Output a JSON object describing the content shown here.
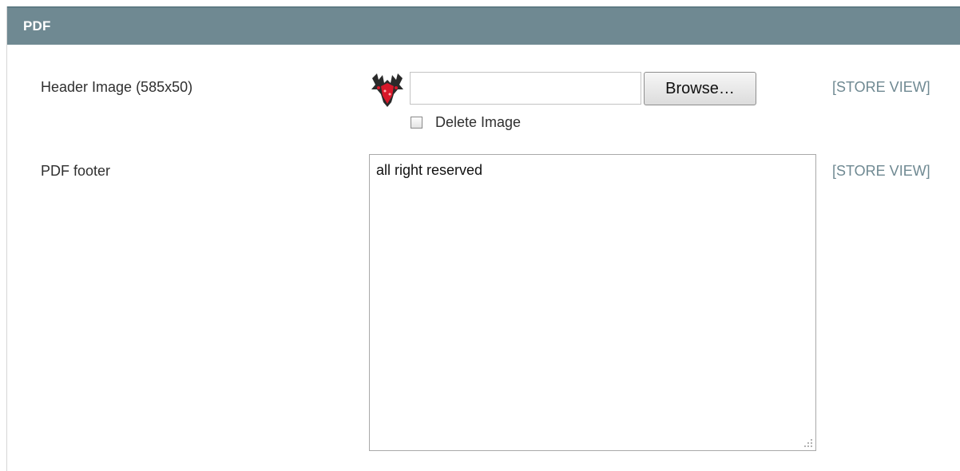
{
  "section": {
    "title": "PDF"
  },
  "header_image": {
    "label": "Header Image (585x50)",
    "file_value": "",
    "browse_label": "Browse…",
    "delete_label": "Delete Image",
    "delete_checked": false,
    "thumbnail_icon": "header-image-thumbnail-icon",
    "scope": "[STORE VIEW]"
  },
  "pdf_footer": {
    "label": "PDF footer",
    "value": "all right reserved",
    "scope": "[STORE VIEW]"
  },
  "colors": {
    "header_bg": "#6f8992",
    "scope_text": "#6f8992"
  }
}
